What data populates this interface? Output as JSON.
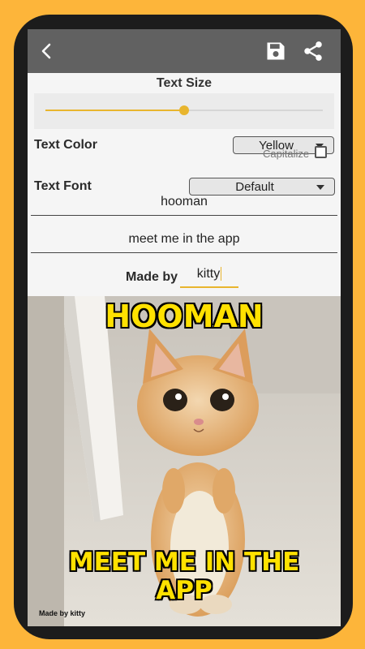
{
  "toolbar": {
    "back_icon": "arrow-left-icon",
    "save_icon": "floppy-disk-icon",
    "share_icon": "share-icon"
  },
  "controls": {
    "text_size_label": "Text Size",
    "text_size_value": 0.5,
    "text_color_label": "Text Color",
    "text_color_selected": "Yellow",
    "capitalize_label": "Capitalize",
    "capitalize_checked": false,
    "text_font_label": "Text Font",
    "text_font_selected": "Default",
    "top_text": "hooman",
    "bottom_text": "meet me in the app",
    "made_by_label": "Made by",
    "made_by_value": "kitty"
  },
  "meme": {
    "top_caption": "HOOMAN",
    "bottom_caption_line1": "MEET ME IN THE",
    "bottom_caption_line2": "APP",
    "watermark": "Made by kitty",
    "caption_color": "#FFE100"
  },
  "colors": {
    "accent": "#E8B52E",
    "background": "#FDB53A",
    "toolbar": "#616161"
  }
}
